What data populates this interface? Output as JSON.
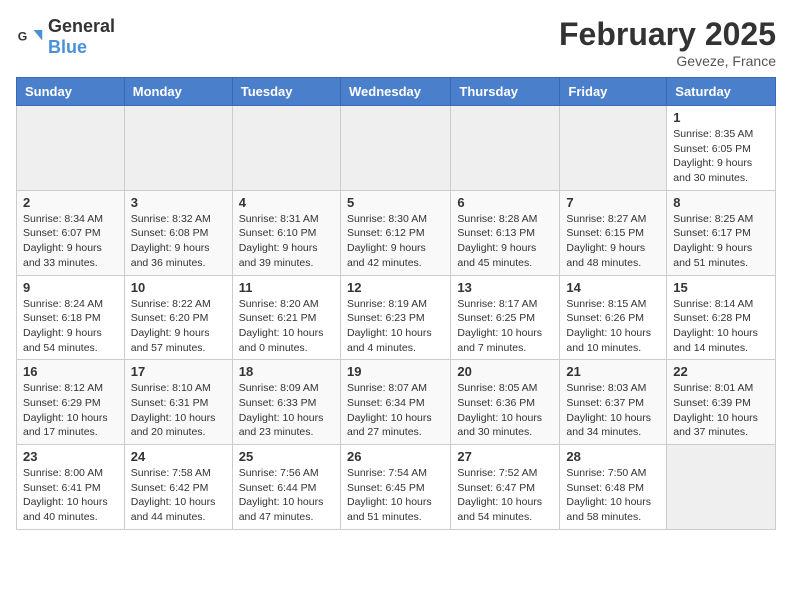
{
  "header": {
    "logo_general": "General",
    "logo_blue": "Blue",
    "month_year": "February 2025",
    "location": "Geveze, France"
  },
  "days_of_week": [
    "Sunday",
    "Monday",
    "Tuesday",
    "Wednesday",
    "Thursday",
    "Friday",
    "Saturday"
  ],
  "weeks": [
    [
      {
        "day": "",
        "info": ""
      },
      {
        "day": "",
        "info": ""
      },
      {
        "day": "",
        "info": ""
      },
      {
        "day": "",
        "info": ""
      },
      {
        "day": "",
        "info": ""
      },
      {
        "day": "",
        "info": ""
      },
      {
        "day": "1",
        "info": "Sunrise: 8:35 AM\nSunset: 6:05 PM\nDaylight: 9 hours and 30 minutes."
      }
    ],
    [
      {
        "day": "2",
        "info": "Sunrise: 8:34 AM\nSunset: 6:07 PM\nDaylight: 9 hours and 33 minutes."
      },
      {
        "day": "3",
        "info": "Sunrise: 8:32 AM\nSunset: 6:08 PM\nDaylight: 9 hours and 36 minutes."
      },
      {
        "day": "4",
        "info": "Sunrise: 8:31 AM\nSunset: 6:10 PM\nDaylight: 9 hours and 39 minutes."
      },
      {
        "day": "5",
        "info": "Sunrise: 8:30 AM\nSunset: 6:12 PM\nDaylight: 9 hours and 42 minutes."
      },
      {
        "day": "6",
        "info": "Sunrise: 8:28 AM\nSunset: 6:13 PM\nDaylight: 9 hours and 45 minutes."
      },
      {
        "day": "7",
        "info": "Sunrise: 8:27 AM\nSunset: 6:15 PM\nDaylight: 9 hours and 48 minutes."
      },
      {
        "day": "8",
        "info": "Sunrise: 8:25 AM\nSunset: 6:17 PM\nDaylight: 9 hours and 51 minutes."
      }
    ],
    [
      {
        "day": "9",
        "info": "Sunrise: 8:24 AM\nSunset: 6:18 PM\nDaylight: 9 hours and 54 minutes."
      },
      {
        "day": "10",
        "info": "Sunrise: 8:22 AM\nSunset: 6:20 PM\nDaylight: 9 hours and 57 minutes."
      },
      {
        "day": "11",
        "info": "Sunrise: 8:20 AM\nSunset: 6:21 PM\nDaylight: 10 hours and 0 minutes."
      },
      {
        "day": "12",
        "info": "Sunrise: 8:19 AM\nSunset: 6:23 PM\nDaylight: 10 hours and 4 minutes."
      },
      {
        "day": "13",
        "info": "Sunrise: 8:17 AM\nSunset: 6:25 PM\nDaylight: 10 hours and 7 minutes."
      },
      {
        "day": "14",
        "info": "Sunrise: 8:15 AM\nSunset: 6:26 PM\nDaylight: 10 hours and 10 minutes."
      },
      {
        "day": "15",
        "info": "Sunrise: 8:14 AM\nSunset: 6:28 PM\nDaylight: 10 hours and 14 minutes."
      }
    ],
    [
      {
        "day": "16",
        "info": "Sunrise: 8:12 AM\nSunset: 6:29 PM\nDaylight: 10 hours and 17 minutes."
      },
      {
        "day": "17",
        "info": "Sunrise: 8:10 AM\nSunset: 6:31 PM\nDaylight: 10 hours and 20 minutes."
      },
      {
        "day": "18",
        "info": "Sunrise: 8:09 AM\nSunset: 6:33 PM\nDaylight: 10 hours and 23 minutes."
      },
      {
        "day": "19",
        "info": "Sunrise: 8:07 AM\nSunset: 6:34 PM\nDaylight: 10 hours and 27 minutes."
      },
      {
        "day": "20",
        "info": "Sunrise: 8:05 AM\nSunset: 6:36 PM\nDaylight: 10 hours and 30 minutes."
      },
      {
        "day": "21",
        "info": "Sunrise: 8:03 AM\nSunset: 6:37 PM\nDaylight: 10 hours and 34 minutes."
      },
      {
        "day": "22",
        "info": "Sunrise: 8:01 AM\nSunset: 6:39 PM\nDaylight: 10 hours and 37 minutes."
      }
    ],
    [
      {
        "day": "23",
        "info": "Sunrise: 8:00 AM\nSunset: 6:41 PM\nDaylight: 10 hours and 40 minutes."
      },
      {
        "day": "24",
        "info": "Sunrise: 7:58 AM\nSunset: 6:42 PM\nDaylight: 10 hours and 44 minutes."
      },
      {
        "day": "25",
        "info": "Sunrise: 7:56 AM\nSunset: 6:44 PM\nDaylight: 10 hours and 47 minutes."
      },
      {
        "day": "26",
        "info": "Sunrise: 7:54 AM\nSunset: 6:45 PM\nDaylight: 10 hours and 51 minutes."
      },
      {
        "day": "27",
        "info": "Sunrise: 7:52 AM\nSunset: 6:47 PM\nDaylight: 10 hours and 54 minutes."
      },
      {
        "day": "28",
        "info": "Sunrise: 7:50 AM\nSunset: 6:48 PM\nDaylight: 10 hours and 58 minutes."
      },
      {
        "day": "",
        "info": ""
      }
    ]
  ]
}
